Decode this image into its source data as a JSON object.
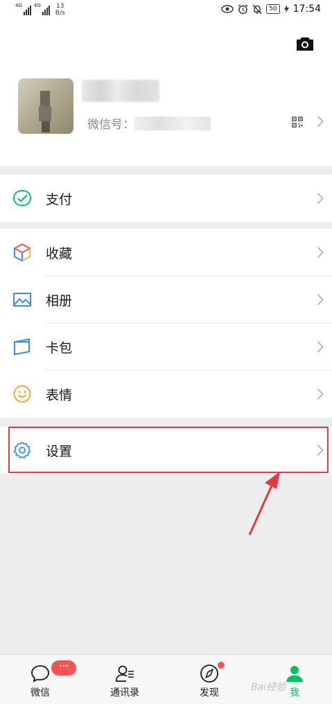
{
  "status_bar": {
    "network1": "4G",
    "network2": "4G",
    "speed_value": "13",
    "speed_unit": "B/s",
    "battery": "50",
    "time": "17:54"
  },
  "profile": {
    "wechat_id_label": "微信号：",
    "icons": [
      "camera-icon",
      "qr-code-icon",
      "chevron-right-icon"
    ]
  },
  "menu": {
    "pay": "支付",
    "favorites": "收藏",
    "album": "相册",
    "cards": "卡包",
    "stickers": "表情",
    "settings": "设置"
  },
  "tabbar": {
    "tabs": [
      {
        "label": "微信",
        "icon": "chat-icon",
        "badge": "···"
      },
      {
        "label": "通讯录",
        "icon": "contacts-icon"
      },
      {
        "label": "发现",
        "icon": "compass-icon",
        "dot": true
      },
      {
        "label": "我",
        "icon": "me-icon",
        "active": true
      }
    ]
  },
  "watermark": "Bai经验",
  "colors": {
    "accent_green": "#07c160",
    "badge_red": "#fa5151",
    "highlight_red": "#e8383d",
    "background": "#ededed"
  }
}
